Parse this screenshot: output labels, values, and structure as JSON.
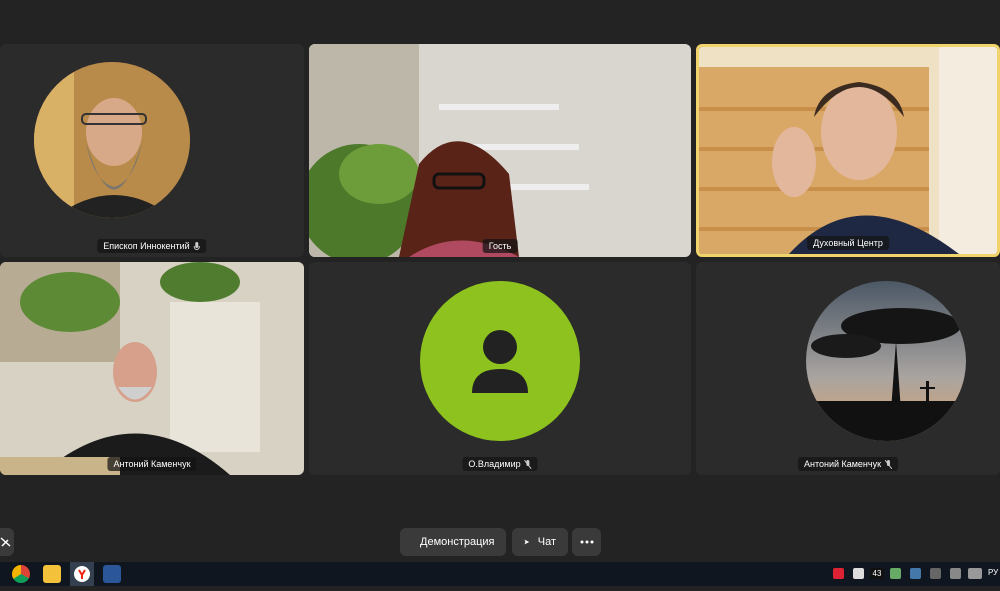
{
  "participants": [
    {
      "name": "Епископ Иннокентий",
      "mic_icon": "mic-icon",
      "avatar_kind": "photo-circle"
    },
    {
      "name": "Гость",
      "avatar_kind": "video"
    },
    {
      "name": "Духовный Центр",
      "avatar_kind": "video",
      "speaking": true
    },
    {
      "name": "Антоний Каменчук",
      "avatar_kind": "video"
    },
    {
      "name": "О.Владимир",
      "mic_icon": "mic-muted-icon",
      "avatar_kind": "placeholder",
      "avatar_color": "#8dc21f"
    },
    {
      "name": "Антоний Каменчук",
      "mic_icon": "mic-muted-icon",
      "avatar_kind": "photo-circle"
    }
  ],
  "controls": {
    "demo_label": "Демонстрация",
    "chat_label": "Чат",
    "more_icon": "more-icon",
    "camera_off_icon": "camera-off-icon"
  },
  "taskbar": {
    "apps": [
      "chrome-icon",
      "folder-icon",
      "yandex-browser-icon",
      "word-icon"
    ],
    "tray_lang": "РУ",
    "tray_number": "43"
  },
  "colors": {
    "background": "#232323",
    "tile": "#2b2b2b",
    "active_border": "#f0d36a",
    "placeholder": "#8dc21f"
  }
}
